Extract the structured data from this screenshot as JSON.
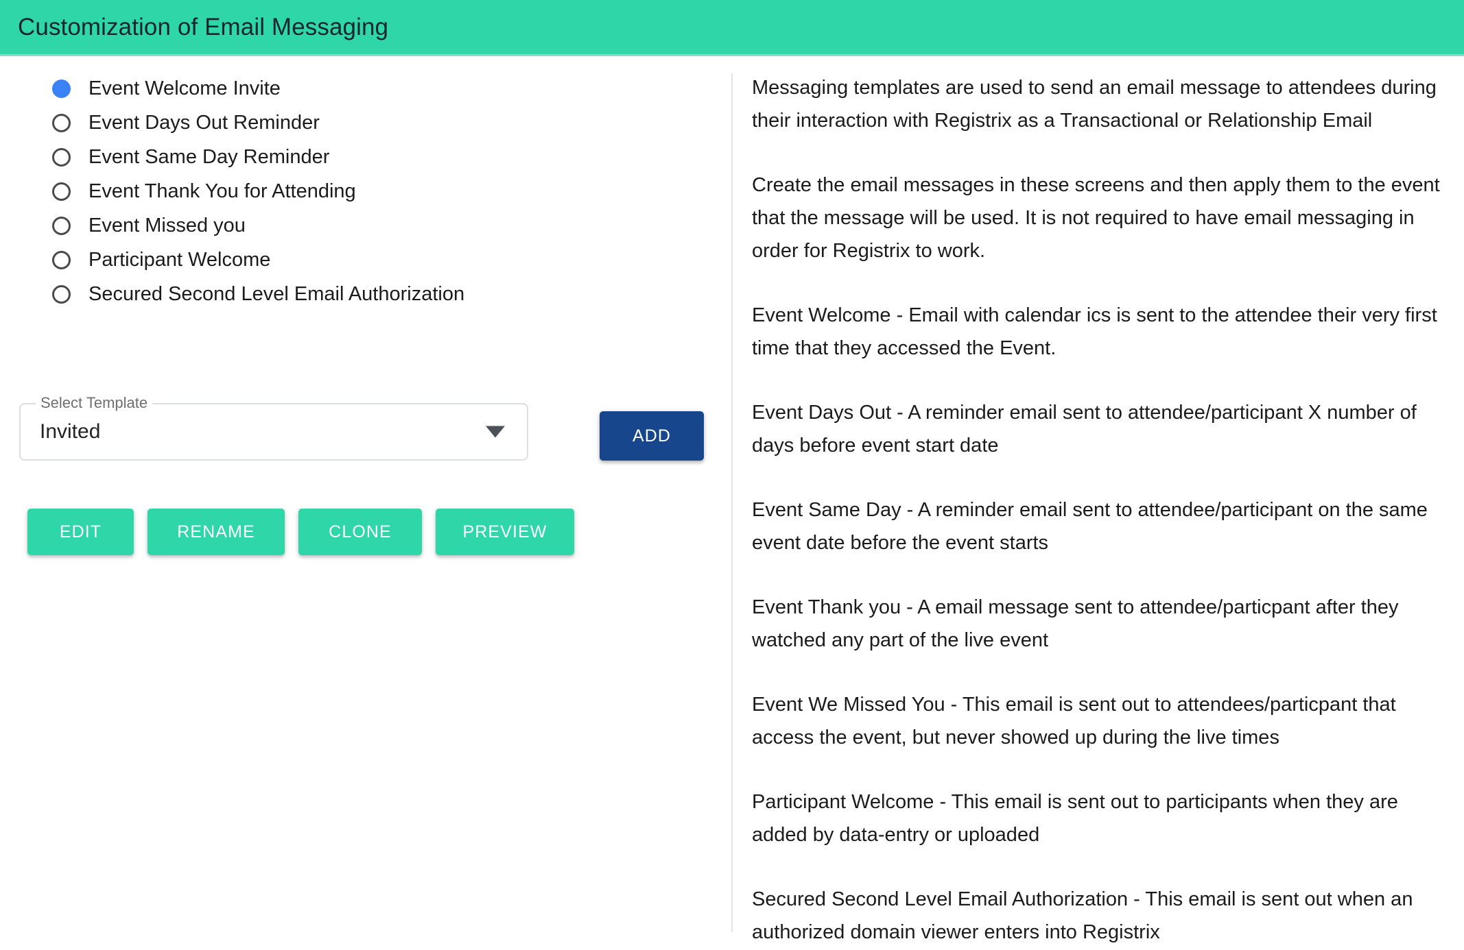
{
  "header": {
    "title": "Customization of Email Messaging",
    "background_color": "#2ed6a8",
    "title_color": "#18272b"
  },
  "left_panel": {
    "radio_group": {
      "name": "message-type",
      "selected_index": 0,
      "selected_color": "#3b82f6",
      "items": [
        {
          "label": "Event Welcome Invite",
          "selected": true
        },
        {
          "label": "Event Days Out Reminder",
          "selected": false
        },
        {
          "label": "Event Same Day Reminder",
          "selected": false
        },
        {
          "label": "Event Thank You for Attending",
          "selected": false
        },
        {
          "label": "Event Missed you",
          "selected": false
        },
        {
          "label": "Participant Welcome",
          "selected": false
        },
        {
          "label": "Secured Second Level Email Authorization",
          "selected": false
        }
      ]
    },
    "select_template": {
      "legend": "Select Template",
      "value": "Invited",
      "arrow_icon": "chevron-down-icon"
    },
    "add_button": {
      "label": "ADD",
      "color": "#17468c"
    },
    "action_buttons": [
      {
        "label": "EDIT"
      },
      {
        "label": "RENAME"
      },
      {
        "label": "CLONE"
      },
      {
        "label": "PREVIEW"
      }
    ],
    "action_button_color": "#2ed6a8"
  },
  "right_panel": {
    "paragraphs": [
      "Messaging templates are used to send an email message to attendees during their interaction with Registrix as a Transactional or Relationship Email",
      "Create the email messages in these screens and then apply them to the event that the message will be used. It is not required to have email messaging in order for Registrix to work.",
      "Event Welcome - Email with calendar ics is sent to the attendee their very first time that they accessed the Event.",
      "Event Days Out - A reminder email sent to attendee/participant X number of days before event start date",
      "Event Same Day - A reminder email sent to attendee/participant on the same event date before the event starts",
      "Event Thank you - A email message sent to attendee/particpant after they watched any part of the live event",
      "Event We Missed You - This email is sent out to attendees/particpant that access the event, but never showed up during the live times",
      "Participant Welcome - This email is sent out to participants when they are added by data-entry or uploaded",
      "Secured Second Level Email Authorization - This email is sent out when an authorized domain viewer enters into Registrix"
    ]
  }
}
